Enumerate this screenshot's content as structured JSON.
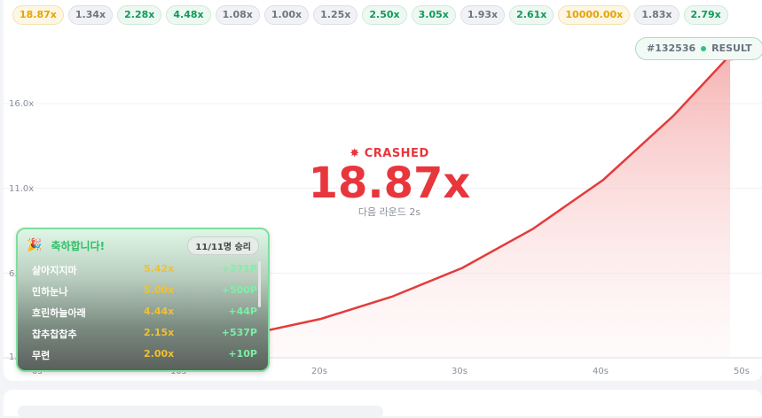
{
  "history": [
    {
      "value": "18.87x",
      "tone": "gold"
    },
    {
      "value": "1.34x",
      "tone": "gray"
    },
    {
      "value": "2.28x",
      "tone": "green"
    },
    {
      "value": "4.48x",
      "tone": "green"
    },
    {
      "value": "1.08x",
      "tone": "gray"
    },
    {
      "value": "1.00x",
      "tone": "gray"
    },
    {
      "value": "1.25x",
      "tone": "gray"
    },
    {
      "value": "2.50x",
      "tone": "green"
    },
    {
      "value": "3.05x",
      "tone": "green"
    },
    {
      "value": "1.93x",
      "tone": "gray"
    },
    {
      "value": "2.61x",
      "tone": "green"
    },
    {
      "value": "10000.00x",
      "tone": "gold"
    },
    {
      "value": "1.83x",
      "tone": "gray"
    },
    {
      "value": "2.79x",
      "tone": "green"
    }
  ],
  "result": {
    "round": "#132536",
    "label": "RESULT"
  },
  "chart_data": {
    "type": "area",
    "y_ticks": [
      "16.0x",
      "11.0x",
      "6.0x",
      "1.0x"
    ],
    "x_ticks": [
      "0s",
      "10s",
      "20s",
      "30s",
      "40s",
      "50s"
    ],
    "x": [
      0,
      5,
      10,
      15,
      20,
      25,
      30,
      35,
      40,
      45,
      49
    ],
    "y": [
      1.0,
      1.3,
      1.75,
      2.4,
      3.3,
      4.6,
      6.3,
      8.6,
      11.5,
      15.3,
      18.87
    ]
  },
  "crash": {
    "label": "CRASHED",
    "multiplier": "18.87x",
    "next_round": "다음 라운드 2s"
  },
  "winners": {
    "title": "축하합니다!",
    "badge": "11/11명 승리",
    "rows": [
      {
        "name": "살아지지마",
        "mult": "5.42x",
        "profit": "+271P"
      },
      {
        "name": "민하눈나",
        "mult": "5.00x",
        "profit": "+500P"
      },
      {
        "name": "흐린하늘아래",
        "mult": "4.44x",
        "profit": "+44P"
      },
      {
        "name": "찹추찹찹추",
        "mult": "2.15x",
        "profit": "+537P"
      },
      {
        "name": "무련",
        "mult": "2.00x",
        "profit": "+10P"
      }
    ]
  },
  "colors": {
    "crash_red": "#e8363d",
    "curve": "#e43b3b",
    "win_green": "#2ec069",
    "gold": "#e6a206"
  }
}
